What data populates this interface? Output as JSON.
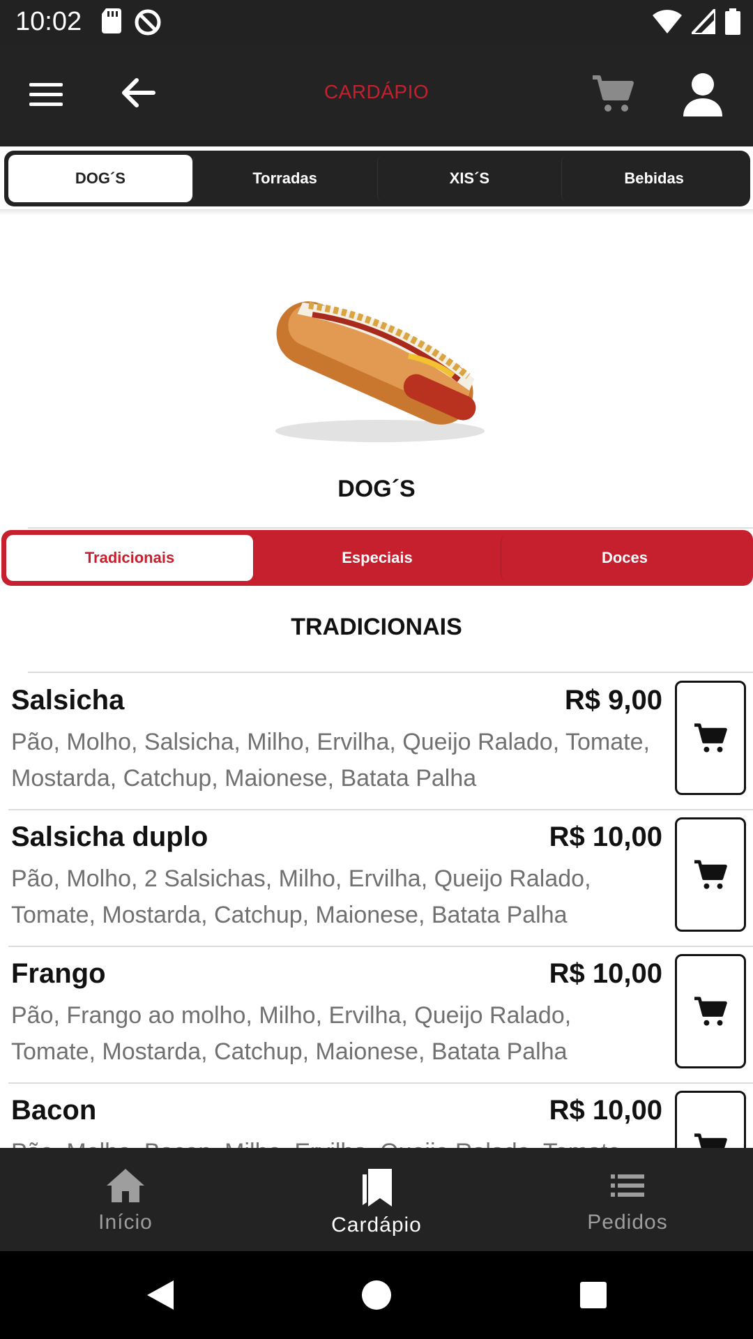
{
  "status_bar": {
    "time": "10:02"
  },
  "app_bar": {
    "title": "CARDÁPIO"
  },
  "categories": [
    {
      "label": "DOG´S",
      "active": true
    },
    {
      "label": "Torradas",
      "active": false
    },
    {
      "label": "XIS´S",
      "active": false
    },
    {
      "label": "Bebidas",
      "active": false
    }
  ],
  "hero": {
    "title": "DOG´S"
  },
  "subcategories": [
    {
      "label": "Tradicionais",
      "active": true
    },
    {
      "label": "Especiais",
      "active": false
    },
    {
      "label": "Doces",
      "active": false
    }
  ],
  "section": {
    "title": "TRADICIONAIS"
  },
  "items": [
    {
      "name": "Salsicha",
      "price": "R$ 9,00",
      "desc": "Pão, Molho, Salsicha, Milho, Ervilha, Queijo Ralado, Tomate, Mostarda, Catchup, Maionese, Batata Palha"
    },
    {
      "name": "Salsicha duplo",
      "price": "R$ 10,00",
      "desc": "Pão, Molho, 2 Salsichas, Milho, Ervilha, Queijo Ralado, Tomate, Mostarda, Catchup, Maionese, Batata Palha"
    },
    {
      "name": "Frango",
      "price": "R$ 10,00",
      "desc": "Pão, Frango ao molho, Milho, Ervilha, Queijo Ralado, Tomate, Mostarda, Catchup, Maionese, Batata Palha"
    },
    {
      "name": "Bacon",
      "price": "R$ 10,00",
      "desc": "Pão, Molho, Bacon, Milho, Ervilha, Queijo Ralado, Tomate"
    }
  ],
  "bottom_nav": [
    {
      "label": "Início",
      "icon": "home-icon",
      "active": false
    },
    {
      "label": "Cardápio",
      "icon": "bookmarks-icon",
      "active": true
    },
    {
      "label": "Pedidos",
      "icon": "list-icon",
      "active": false
    }
  ],
  "colors": {
    "accent": "#c6202e",
    "bar": "#232323"
  }
}
